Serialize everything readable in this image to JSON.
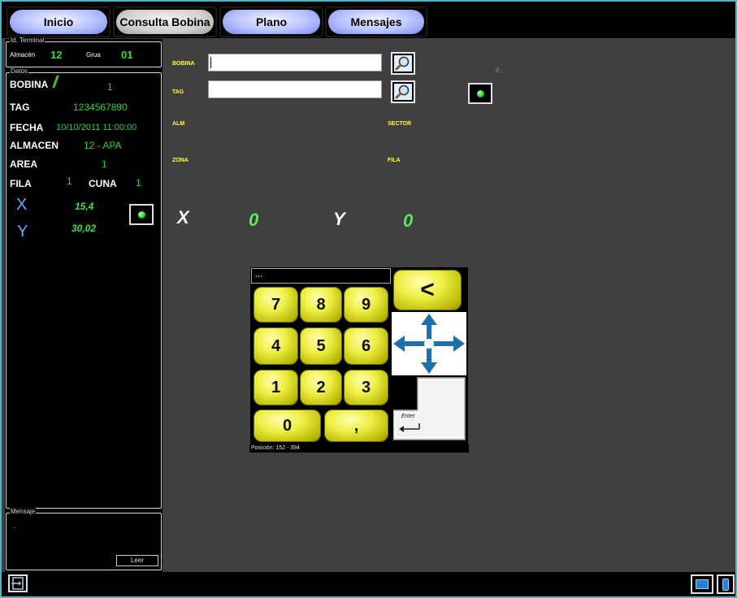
{
  "tabs": [
    {
      "label": "Inicio"
    },
    {
      "label": "Consulta Bobina"
    },
    {
      "label": "Plano"
    },
    {
      "label": "Mensajes"
    }
  ],
  "terminal": {
    "legend": "Id. Terminal",
    "almacen_label": "Almacén",
    "almacen_value": "12",
    "grua_label": "Grua",
    "grua_value": "01"
  },
  "datos": {
    "legend": "Datos",
    "bobina_label": "BOBINA",
    "bobina_value": "1",
    "tag_label": "TAG",
    "tag_value": "1234567890",
    "fecha_label": "FECHA",
    "fecha_value": "10/10/2011 11:00:00",
    "almacen_label": "ALMACEN",
    "almacen_value": "12 - APA",
    "area_label": "AREA",
    "area_value": "1",
    "fila_label": "FILA",
    "fila_value": "1",
    "cuna_label": "CUNA",
    "cuna_value": "1",
    "x_label": "X",
    "x_value": "15,4",
    "y_label": "Y",
    "y_value": "30,02"
  },
  "mensaje": {
    "legend": "Mensaje",
    "text": "-",
    "leer_label": "Leer"
  },
  "form": {
    "bobina_label": "BOBINA",
    "bobina_value": "",
    "tag_label": "TAG",
    "tag_value": "",
    "alm_label": "ALM",
    "sector_label": "SECTOR",
    "zona_label": "ZONA",
    "fila_label": "FILA",
    "status_text": "// :",
    "x_label": "X",
    "x_value": "0",
    "y_label": "Y",
    "y_value": "0"
  },
  "keypad": {
    "display": "...",
    "keys": [
      "7",
      "8",
      "9",
      "4",
      "5",
      "6",
      "1",
      "2",
      "3",
      "0",
      ","
    ],
    "back_label": "<",
    "enter_label": "Enter",
    "position_text": "Posición: 152 - 394"
  },
  "colors": {
    "accent": "#4fb3c7",
    "value_green": "#33cc33",
    "label_yellow": "#ffff33",
    "key_yellow": "#eeee44",
    "arrow_blue": "#1f6fa8"
  }
}
